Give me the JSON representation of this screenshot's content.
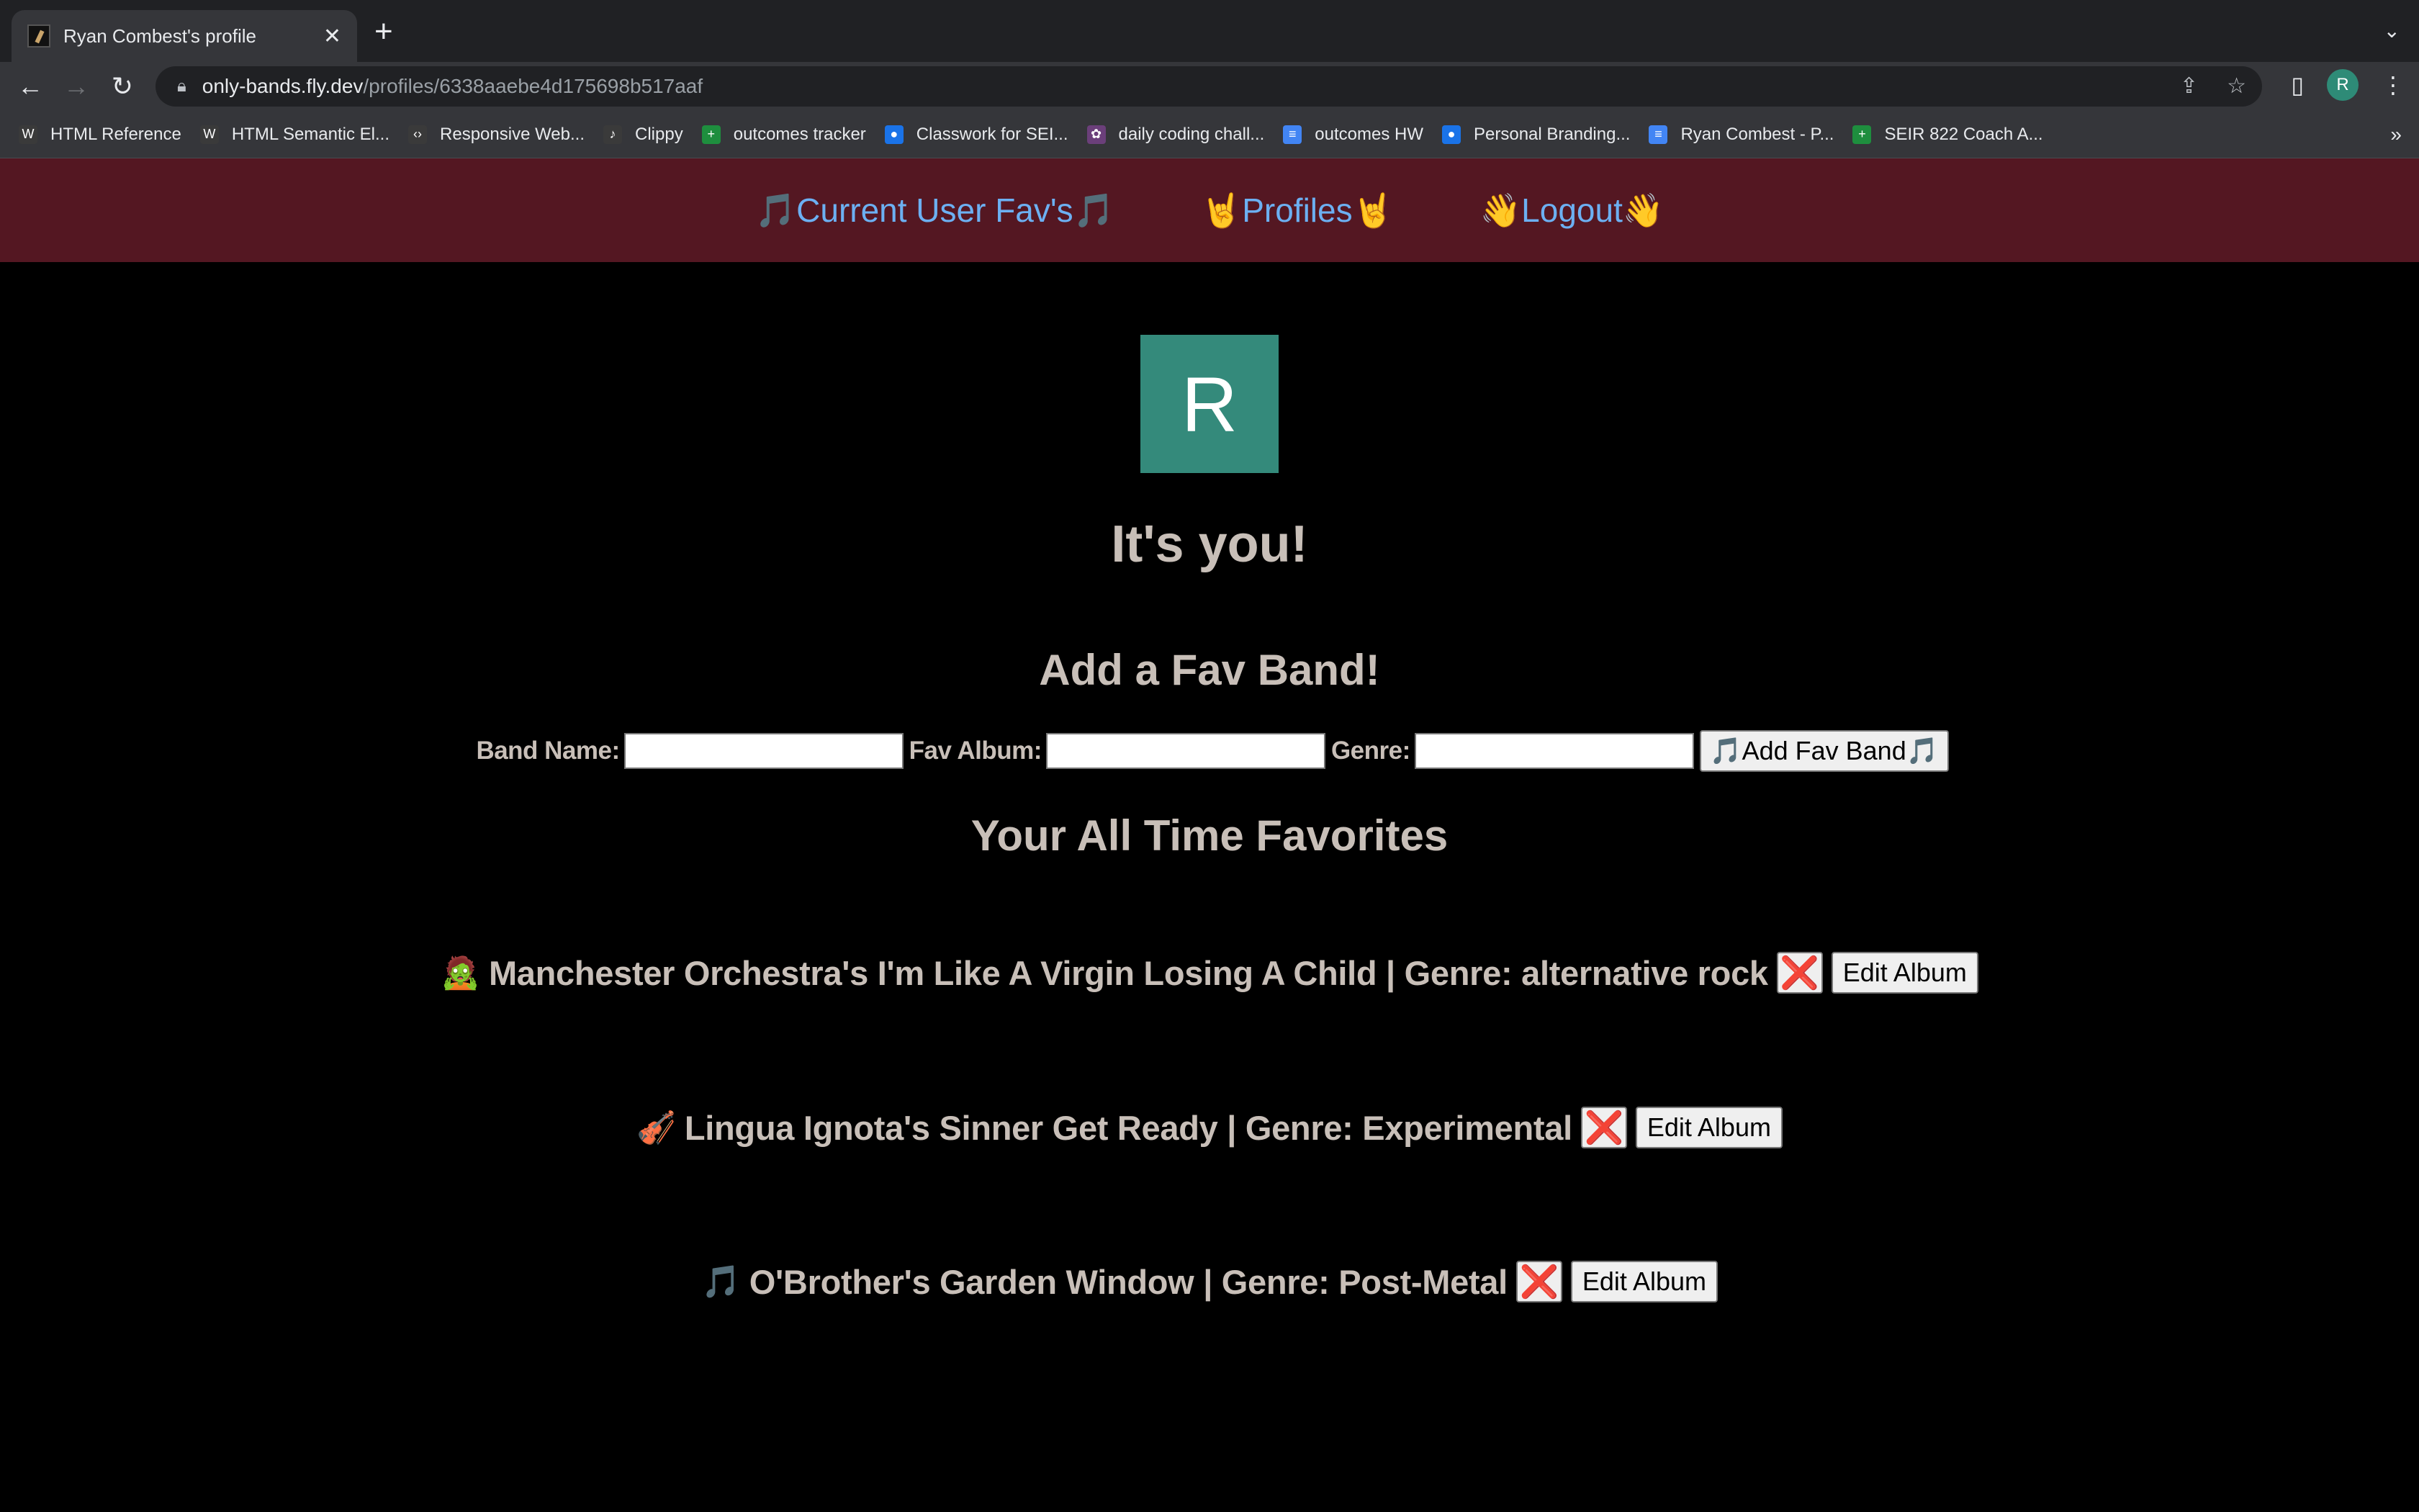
{
  "browser": {
    "tab_title": "Ryan Combest's profile",
    "new_tab": "+",
    "close_tab": "✕",
    "url_host": "only-bands.fly.dev",
    "url_path": "/profiles/6338aaebe4d175698b517aaf",
    "avatar_letter": "R",
    "bookmarks": [
      {
        "label": "HTML Reference",
        "icon": "w3schools-icon",
        "color": "#3a3a3a"
      },
      {
        "label": "HTML Semantic El...",
        "icon": "w3schools-icon",
        "color": "#3a3a3a"
      },
      {
        "label": "Responsive Web...",
        "icon": "code-icon",
        "color": "#3a3a3a"
      },
      {
        "label": "Clippy",
        "icon": "clippy-icon",
        "color": "#3a3a3a"
      },
      {
        "label": "outcomes tracker",
        "icon": "sheets-icon",
        "color": "#1e8e3e"
      },
      {
        "label": "Classwork for SEI...",
        "icon": "classroom-icon",
        "color": "#1a73e8"
      },
      {
        "label": "daily coding chall...",
        "icon": "flower-icon",
        "color": "#6b3f7a"
      },
      {
        "label": "outcomes HW",
        "icon": "docs-icon",
        "color": "#4285f4"
      },
      {
        "label": "Personal Branding...",
        "icon": "classroom-icon",
        "color": "#1a73e8"
      },
      {
        "label": "Ryan Combest - P...",
        "icon": "docs-icon",
        "color": "#4285f4"
      },
      {
        "label": "SEIR 822 Coach A...",
        "icon": "sheets-icon",
        "color": "#1e8e3e"
      }
    ],
    "bookmarks_more": "»"
  },
  "nav": {
    "current_favs": "🎵Current User Fav's🎵",
    "profiles": "🤘Profiles🤘",
    "logout": "👋Logout👋"
  },
  "profile": {
    "avatar_letter": "R",
    "avatar_color": "#348a7b",
    "greeting": "It's you!"
  },
  "form": {
    "heading": "Add a Fav Band!",
    "band_label": "Band Name:",
    "album_label": "Fav Album:",
    "genre_label": "Genre:",
    "band_value": "",
    "album_value": "",
    "genre_value": "",
    "submit": "🎵Add Fav Band🎵"
  },
  "favorites": {
    "heading": "Your All Time Favorites",
    "delete_label": "❌",
    "edit_label": "Edit Album",
    "items": [
      {
        "emoji": "🧟",
        "text": "Manchester Orchestra's I'm Like A Virgin Losing A Child | Genre: alternative rock"
      },
      {
        "emoji": "🎻",
        "text": "Lingua Ignota's Sinner Get Ready | Genre: Experimental"
      },
      {
        "emoji": "🎵",
        "text": "O'Brother's Garden Window | Genre: Post-Metal"
      }
    ]
  },
  "colors": {
    "nav_bg": "#541722",
    "nav_link": "#6cb0f2",
    "text": "#c8bfb8",
    "delete": "#e0201a"
  }
}
